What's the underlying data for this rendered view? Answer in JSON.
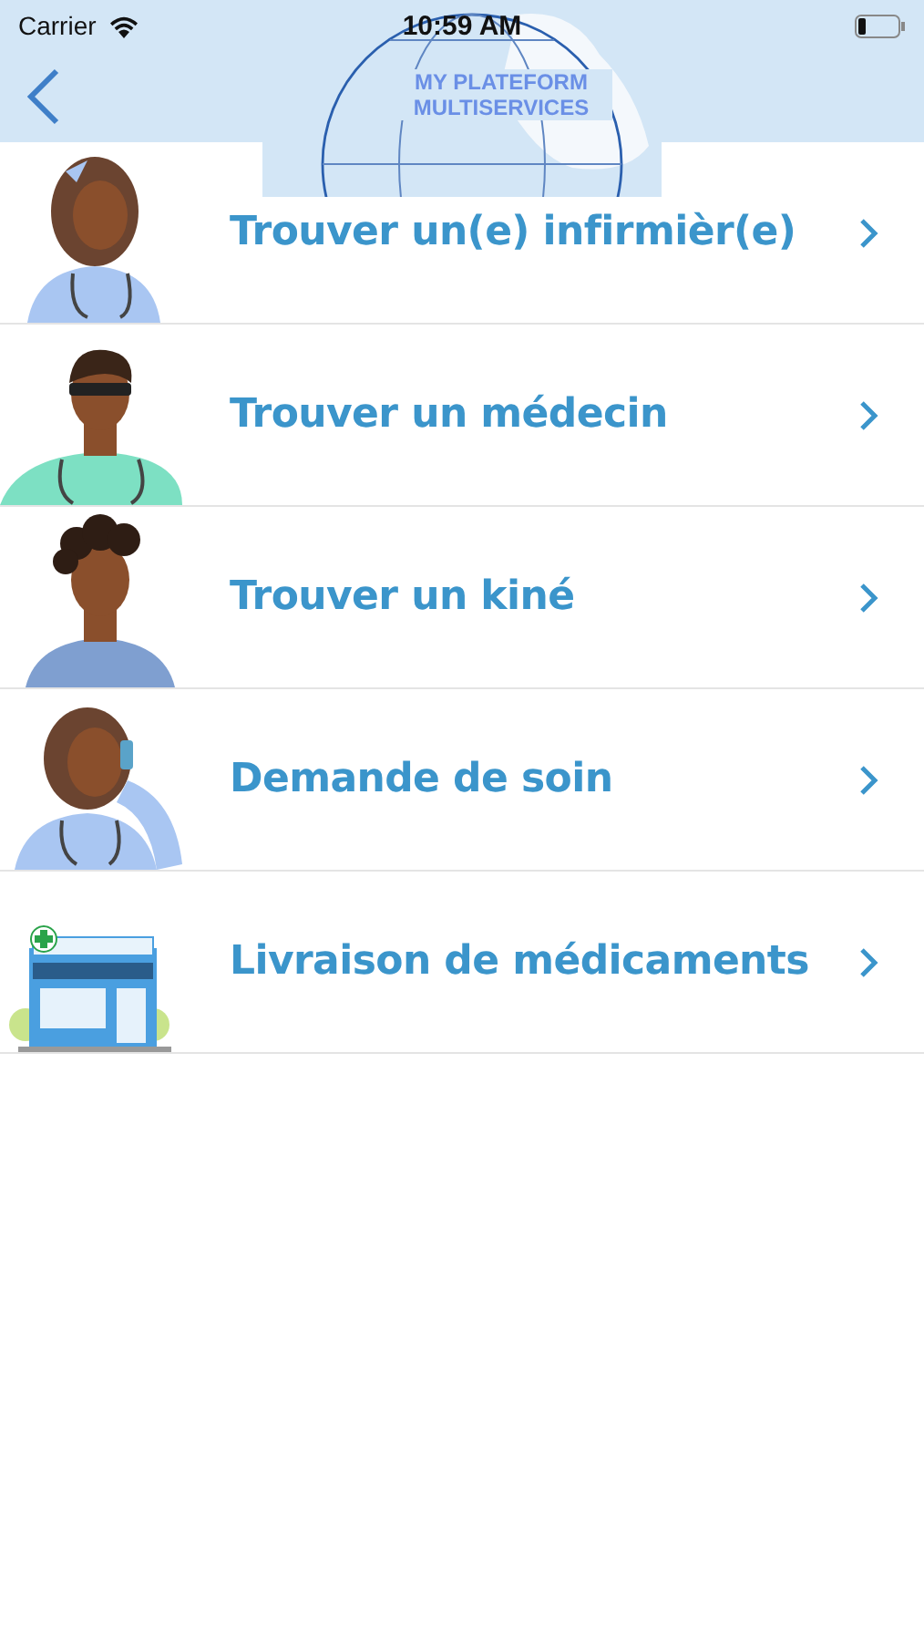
{
  "status_bar": {
    "carrier": "Carrier",
    "time": "10:59 AM"
  },
  "nav_bar": {
    "logo": {
      "title": "MY PLATEFORM MULTISERVICES"
    }
  },
  "menu": [
    {
      "label": "Trouver un(e) infirmièr(e)",
      "kind": "nurse"
    },
    {
      "label": "Trouver un médecin",
      "kind": "doctor"
    },
    {
      "label": "Trouver un kiné",
      "kind": "physio"
    },
    {
      "label": "Demande de soin",
      "kind": "caller"
    },
    {
      "label": "Livraison de médicaments",
      "kind": "pharmacy"
    }
  ]
}
